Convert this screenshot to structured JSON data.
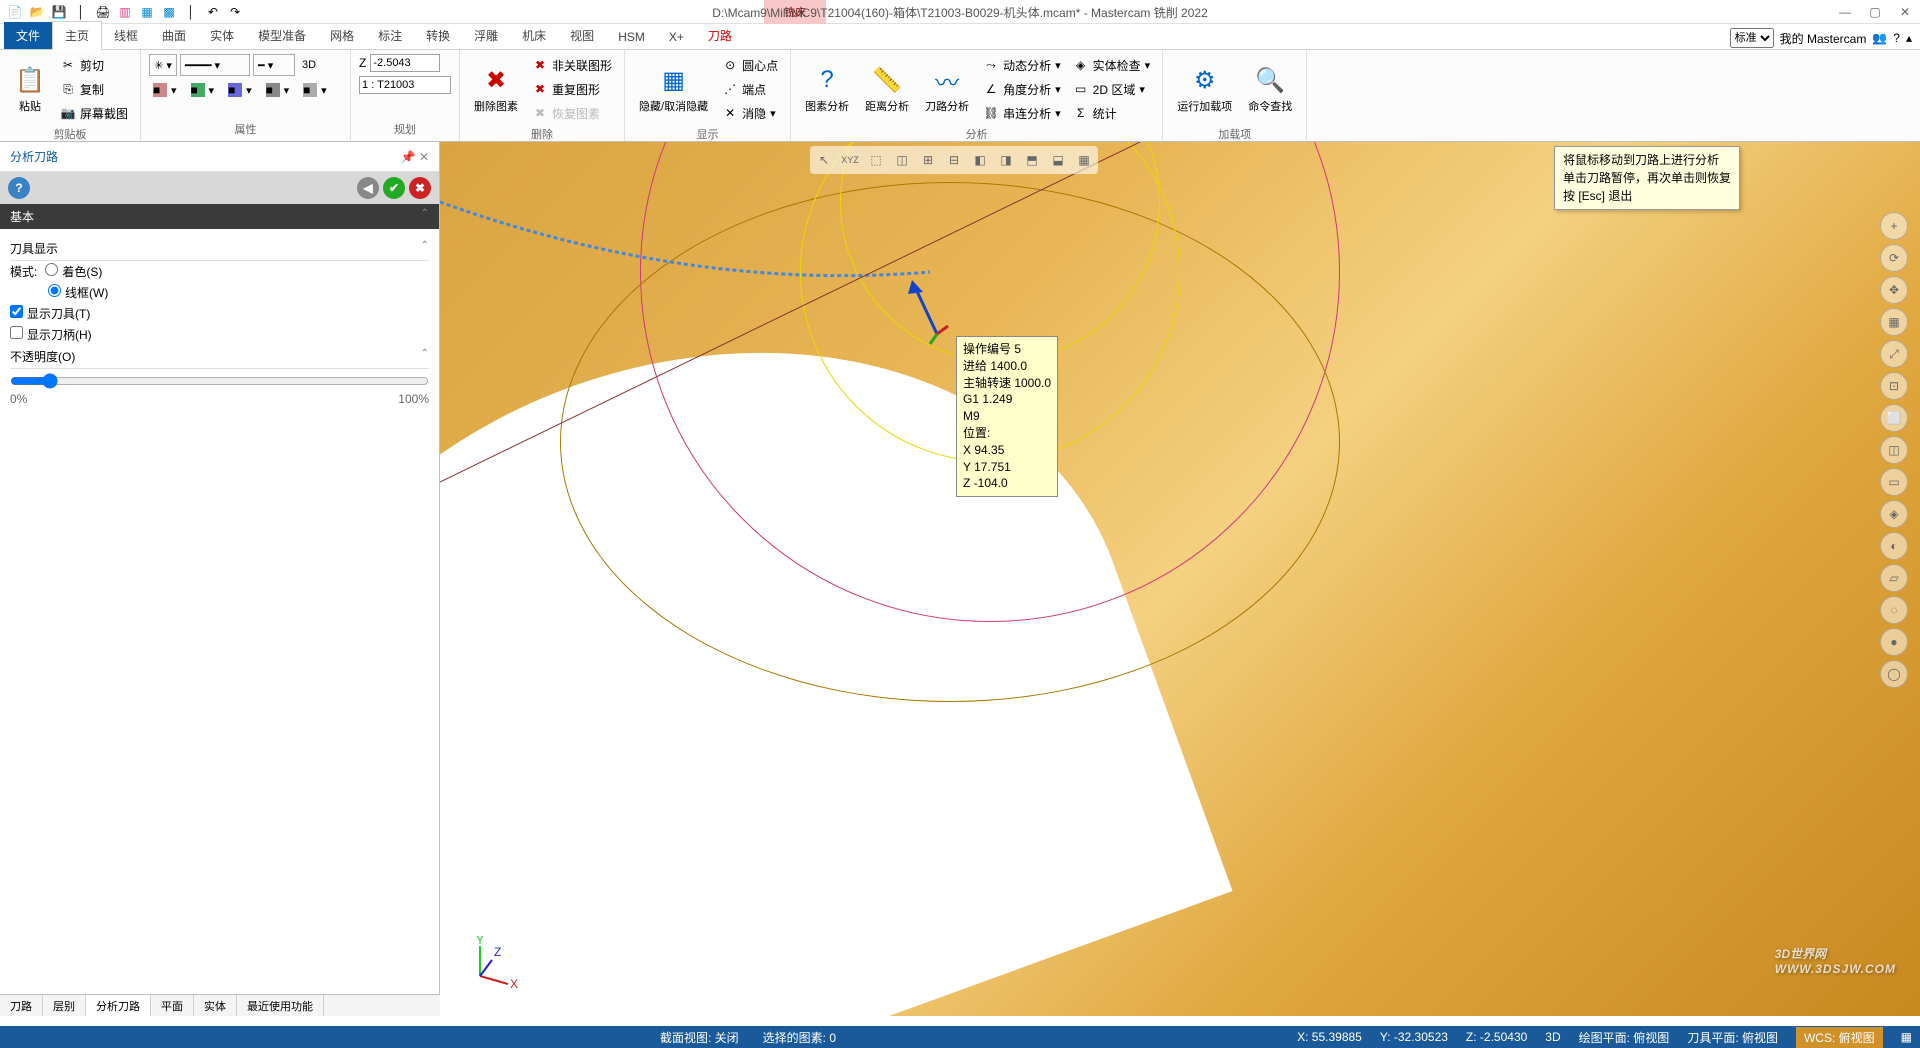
{
  "title": "D:\\Mcam9\\Mill\\MC9\\T21004(160)-箱体\\T21003-B0029-机头体.mcam* - Mastercam 铣削 2022",
  "context_tab": "铣床",
  "ribbon": {
    "file": "文件",
    "tabs": [
      "主页",
      "线框",
      "曲面",
      "实体",
      "模型准备",
      "网格",
      "标注",
      "转换",
      "浮雕",
      "机床",
      "视图",
      "HSM",
      "X+",
      "刀路"
    ],
    "active": 0,
    "right_dropdown": "标准",
    "right_link": "我的 Mastercam",
    "groups": {
      "clipboard": {
        "label": "剪贴板",
        "paste": "粘贴",
        "cut": "剪切",
        "copy": "复制",
        "screenshot": "屏幕截图"
      },
      "attrs": {
        "label": "属性",
        "mode3d": "3D"
      },
      "plan": {
        "label": "规划",
        "z_label": "Z",
        "z_val": "-2.5043",
        "tool_label": "1 : T21003"
      },
      "delete": {
        "label": "删除",
        "del_elem": "删除图素",
        "irrelevant": "非关联图形",
        "dup": "重复图形",
        "restore": "恢复图素"
      },
      "display": {
        "label": "显示",
        "hide": "隐藏/取消隐藏",
        "center": "圆心点",
        "endpt": "端点",
        "clear": "消隐"
      },
      "analyze": {
        "label": "分析",
        "elem": "图素分析",
        "dist": "距离分析",
        "tool": "刀路分析",
        "dyn": "动态分析",
        "angle": "角度分析",
        "chain": "串连分析",
        "solid": "实体检查",
        "2d": "2D 区域",
        "stat": "统计"
      },
      "addin": {
        "label": "加载项",
        "run": "运行加载项",
        "cmd": "命令查找"
      }
    }
  },
  "panel": {
    "title": "分析刀路",
    "section": "基本",
    "tool_display": "刀具显示",
    "mode_label": "模式:",
    "mode_shade": "着色(S)",
    "mode_wire": "线框(W)",
    "show_tool": "显示刀具(T)",
    "show_holder": "显示刀柄(H)",
    "opacity": "不透明度(O)",
    "pct0": "0%",
    "pct100": "100%"
  },
  "panel_tabs": [
    "刀路",
    "层别",
    "分析刀路",
    "平面",
    "实体",
    "最近使用功能"
  ],
  "panel_tabs_active": 2,
  "hint": {
    "l1": "将鼠标移动到刀路上进行分析",
    "l2": "单击刀路暂停，再次单击则恢复",
    "l3": "按 [Esc] 退出"
  },
  "info": {
    "op": "操作编号 5",
    "feed": "进给 1400.0",
    "spindle": "主轴转速 1000.0",
    "g": "G1 1.249",
    "m": "M9",
    "pos": "位置:",
    "x": " X 94.35",
    "y": " Y 17.751",
    "z": " Z -104.0"
  },
  "status": {
    "sectview": "截面视图: 关闭",
    "selcount": "选择的图素: 0",
    "x": "X:   55.39885",
    "y": "Y:   -32.30523",
    "z": "Z:   -2.50430",
    "dim": "3D",
    "drawplane": "绘图平面: 俯视图",
    "toolplane": "刀具平面: 俯视图",
    "wcs": "WCS: 俯视图"
  },
  "watermark": "3D世界网",
  "watermark_url": "WWW.3DSJW.COM"
}
